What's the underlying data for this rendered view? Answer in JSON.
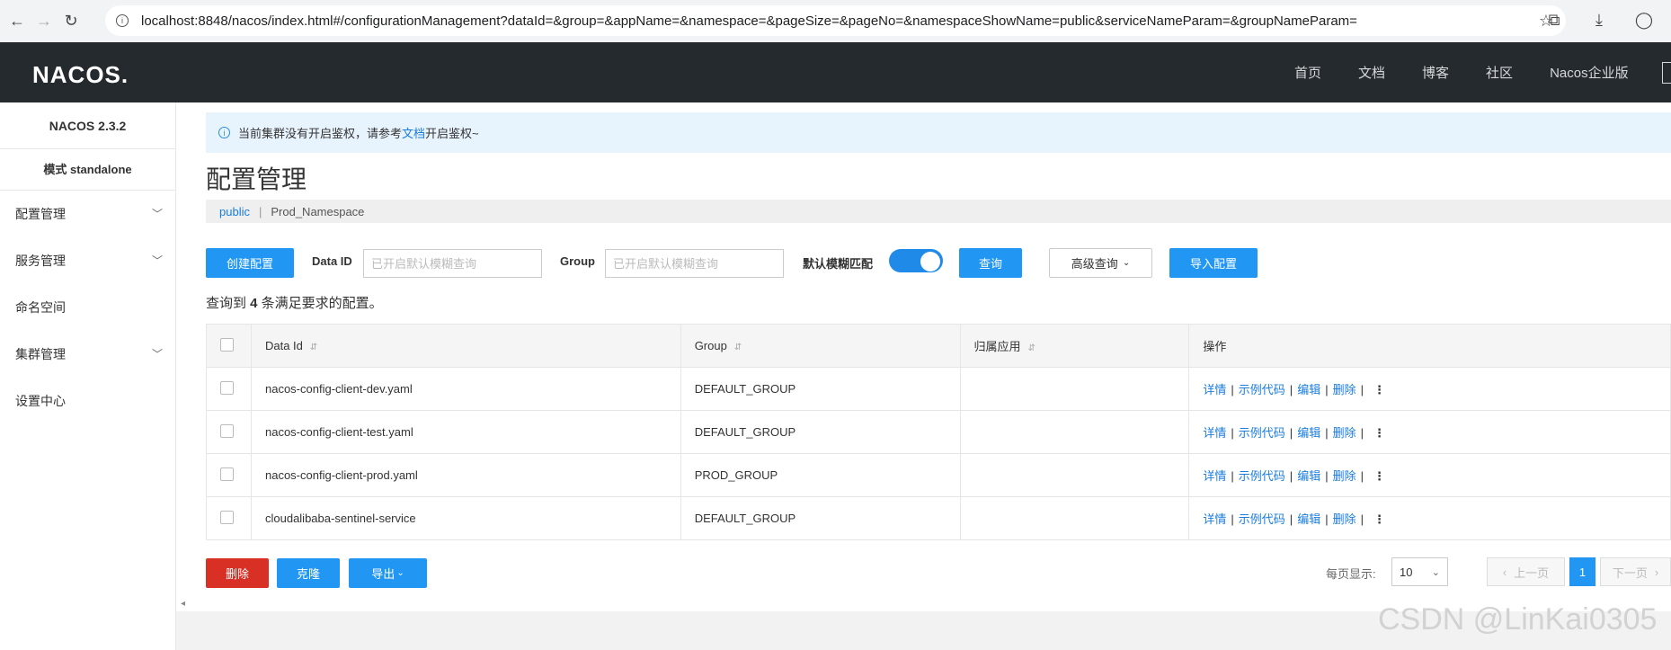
{
  "browser": {
    "url": "localhost:8848/nacos/index.html#/configurationManagement?dataId=&group=&appName=&namespace=&pageSize=&pageNo=&namespaceShowName=public&serviceNameParam=&groupNameParam="
  },
  "header": {
    "logo": "NACOS.",
    "nav": [
      "首页",
      "文档",
      "博客",
      "社区",
      "Nacos企业版"
    ]
  },
  "sidebar": {
    "version": "NACOS 2.3.2",
    "mode": "模式 standalone",
    "items": [
      {
        "label": "配置管理",
        "expandable": true
      },
      {
        "label": "服务管理",
        "expandable": true
      },
      {
        "label": "命名空间",
        "expandable": false
      },
      {
        "label": "集群管理",
        "expandable": true
      },
      {
        "label": "设置中心",
        "expandable": false
      }
    ]
  },
  "notice": {
    "before": "当前集群没有开启鉴权，请参考",
    "link": "文档",
    "after": "开启鉴权~"
  },
  "page": {
    "title": "配置管理"
  },
  "namespaces": {
    "active": "public",
    "other": "Prod_Namespace"
  },
  "toolbar": {
    "create_label": "创建配置",
    "dataid_label": "Data ID",
    "dataid_placeholder": "已开启默认模糊查询",
    "group_label": "Group",
    "group_placeholder": "已开启默认模糊查询",
    "fuzzy_label": "默认模糊匹配",
    "fuzzy_on": true,
    "query_label": "查询",
    "advanced_label": "高级查询",
    "import_label": "导入配置"
  },
  "result": {
    "prefix": "查询到 ",
    "count": "4",
    "suffix": " 条满足要求的配置。"
  },
  "table": {
    "headers": [
      "Data Id",
      "Group",
      "归属应用",
      "操作"
    ],
    "rows": [
      {
        "dataId": "nacos-config-client-dev.yaml",
        "group": "DEFAULT_GROUP",
        "app": ""
      },
      {
        "dataId": "nacos-config-client-test.yaml",
        "group": "DEFAULT_GROUP",
        "app": ""
      },
      {
        "dataId": "nacos-config-client-prod.yaml",
        "group": "PROD_GROUP",
        "app": ""
      },
      {
        "dataId": "cloudalibaba-sentinel-service",
        "group": "DEFAULT_GROUP",
        "app": ""
      }
    ],
    "actions": [
      "详情",
      "示例代码",
      "编辑",
      "删除"
    ]
  },
  "footer": {
    "delete_label": "删除",
    "clone_label": "克隆",
    "export_label": "导出",
    "page_size_label": "每页显示:",
    "page_size": "10",
    "prev_label": "上一页",
    "current_page": "1",
    "next_label": "下一页"
  },
  "watermark": "CSDN @LinKai0305"
}
